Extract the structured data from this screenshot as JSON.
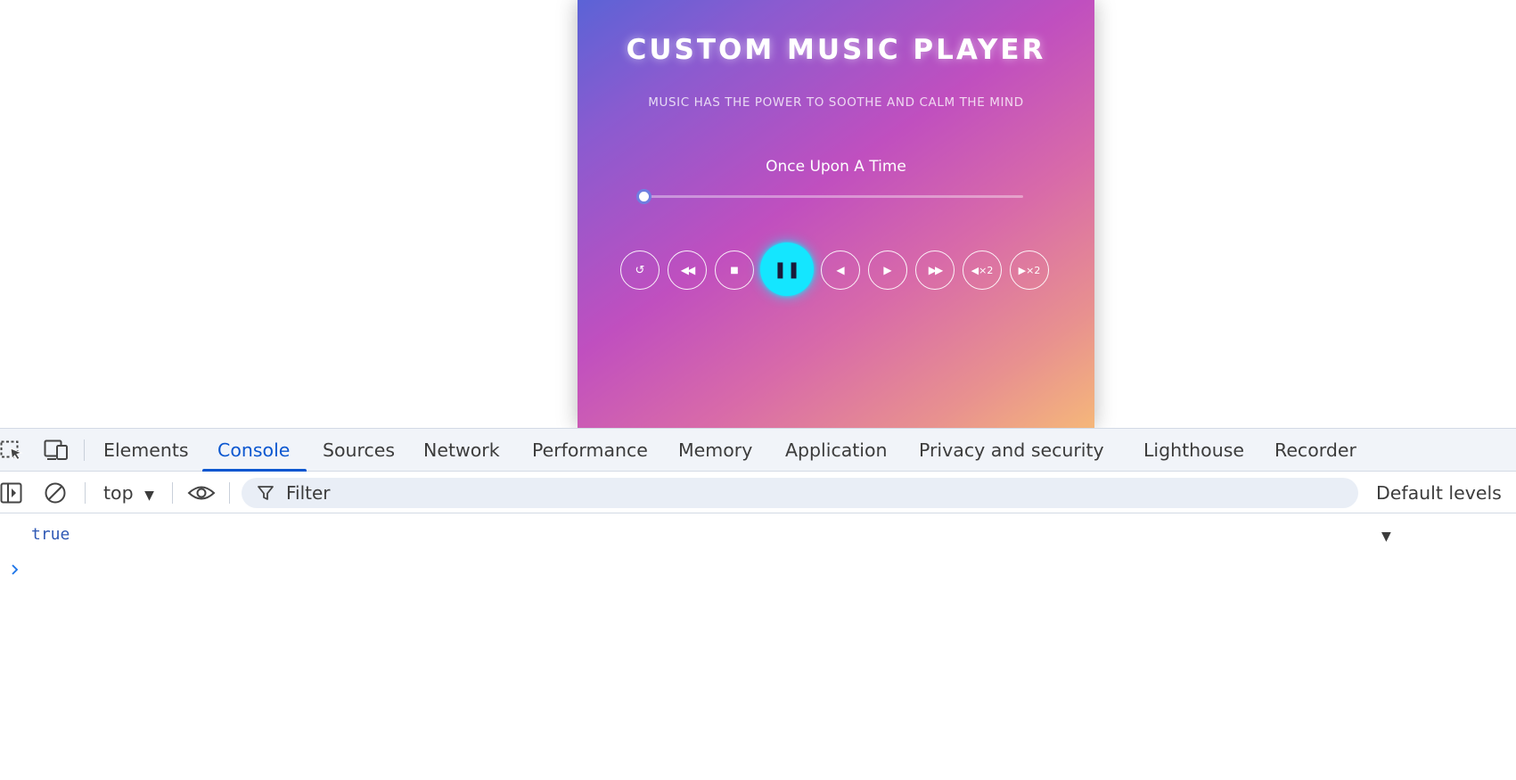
{
  "player": {
    "title": "CUSTOM MUSIC PLAYER",
    "subtitle": "MUSIC HAS THE POWER TO SOOTHE AND CALM THE MIND",
    "track_title": "Once Upon A Time",
    "progress_fraction": 0.0,
    "controls": [
      {
        "name": "restart-button",
        "label": "↺"
      },
      {
        "name": "rewind-button",
        "label": "◀◀"
      },
      {
        "name": "stop-button",
        "label": "■"
      },
      {
        "name": "pause-button",
        "label": "❚❚"
      },
      {
        "name": "step-back-button",
        "label": "◀"
      },
      {
        "name": "play-forward-button",
        "label": "▶"
      },
      {
        "name": "fast-forward-button",
        "label": "▶▶"
      },
      {
        "name": "slow-down-button",
        "label": "◀×2"
      },
      {
        "name": "speed-up-button",
        "label": "▶×2"
      }
    ],
    "colors": {
      "play_button": "#14e6ff",
      "gradient_start": "#5b63d6",
      "gradient_end": "#f5b77a"
    }
  },
  "devtools": {
    "tabs": [
      "Elements",
      "Console",
      "Sources",
      "Network",
      "Performance",
      "Memory",
      "Application",
      "Privacy and security",
      "Lighthouse",
      "Recorder"
    ],
    "active_tab": "Console",
    "toolbar": {
      "context": "top",
      "filter_placeholder": "Filter",
      "levels": "Default levels"
    },
    "console_output": [
      "true"
    ],
    "colors": {
      "accent": "#0b57d0",
      "output_text": "#2f59b5"
    }
  }
}
